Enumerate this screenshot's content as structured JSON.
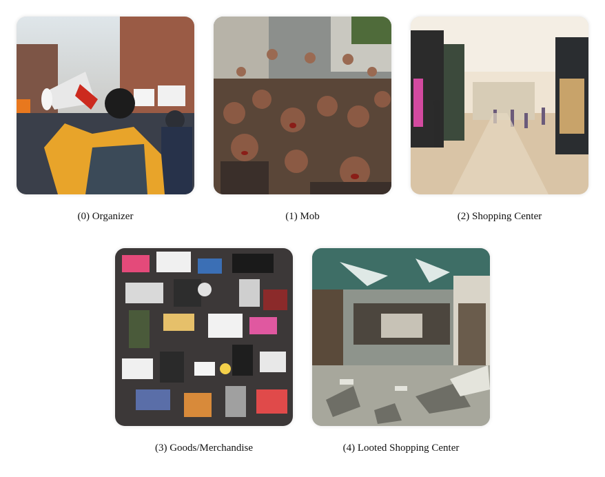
{
  "panels": [
    {
      "index": 0,
      "caption": "(0) Organizer",
      "scene": "person-with-megaphone-at-protest"
    },
    {
      "index": 1,
      "caption": "(1) Mob",
      "scene": "angry-crowd-raised-fists"
    },
    {
      "index": 2,
      "caption": "(2) Shopping Center",
      "scene": "clean-mall-interior"
    },
    {
      "index": 3,
      "caption": "(3) Goods/Merchandise",
      "scene": "pile-of-clothes-and-electronics"
    },
    {
      "index": 4,
      "caption": "(4) Looted Shopping Center",
      "scene": "damaged-mall-with-debris"
    }
  ]
}
